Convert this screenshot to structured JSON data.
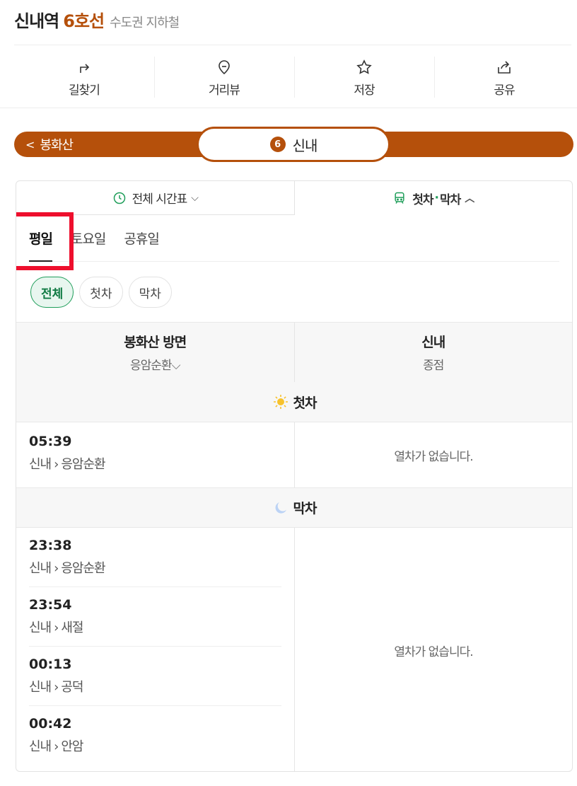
{
  "header": {
    "station": "신내역",
    "line": "6호선",
    "region": "수도권 지하철"
  },
  "actions": [
    {
      "label": "길찾기",
      "icon": "directions-icon"
    },
    {
      "label": "거리뷰",
      "icon": "map-pin-icon"
    },
    {
      "label": "저장",
      "icon": "star-icon"
    },
    {
      "label": "공유",
      "icon": "share-icon"
    }
  ],
  "line_bar": {
    "prev": "봉화산",
    "line_number": "6",
    "current": "신내",
    "color": "#b5500b"
  },
  "mode_tabs": {
    "full": "전체 시간표",
    "first": "첫차",
    "separator": "·",
    "last": "막차"
  },
  "day_tabs": [
    "평일",
    "토요일",
    "공휴일"
  ],
  "active_day": "평일",
  "filters": [
    "전체",
    "첫차",
    "막차"
  ],
  "active_filter": "전체",
  "directions": [
    {
      "title": "봉화산 방면",
      "sub": "응암순환"
    },
    {
      "title": "신내",
      "sub": "종점"
    }
  ],
  "sections": {
    "first": "첫차",
    "last": "막차"
  },
  "first_trains": [
    {
      "time": "05:39",
      "from": "신내",
      "arrow": "›",
      "to": "응암순환"
    }
  ],
  "last_trains": [
    {
      "time": "23:38",
      "from": "신내",
      "arrow": "›",
      "to": "응암순환"
    },
    {
      "time": "23:54",
      "from": "신내",
      "arrow": "›",
      "to": "새절"
    },
    {
      "time": "00:13",
      "from": "신내",
      "arrow": "›",
      "to": "공덕"
    },
    {
      "time": "00:42",
      "from": "신내",
      "arrow": "›",
      "to": "안암"
    }
  ],
  "no_train_text": "열차가 없습니다.",
  "colors": {
    "accent": "#b5500b",
    "green": "#1f9e5a",
    "highlight": "#ee0f2d"
  }
}
